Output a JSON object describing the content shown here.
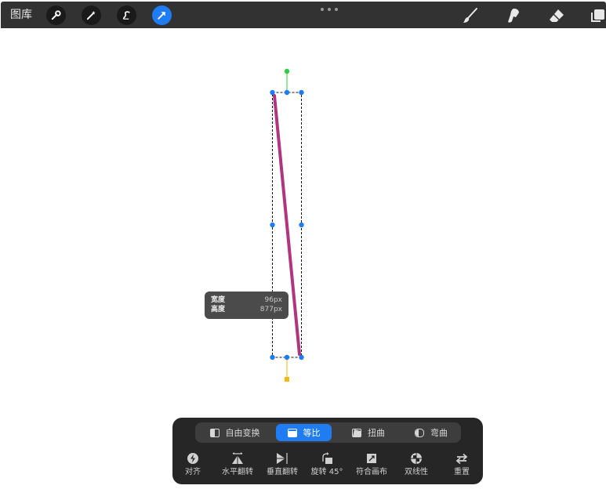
{
  "topbar": {
    "gallery_label": "图库",
    "tools": [
      {
        "icon": "wrench-icon"
      },
      {
        "icon": "magic-wand-icon"
      },
      {
        "icon": "selection-icon"
      },
      {
        "icon": "transform-arrow-icon",
        "active": true
      }
    ],
    "right_tools": [
      {
        "icon": "brush-icon"
      },
      {
        "icon": "smudge-icon"
      },
      {
        "icon": "eraser-icon"
      },
      {
        "icon": "layers-icon"
      }
    ],
    "accent_color": "#1f7cf3",
    "bar_color": "#323232"
  },
  "canvas": {
    "stroke_color": "#b0357e",
    "handle_color": "#1f7cf3",
    "rotate_handle_color": "#2ecc40",
    "anchor_handle_color": "#f5b80f"
  },
  "size_tooltip": {
    "width_label": "宽度",
    "width_value": "96px",
    "height_label": "高度",
    "height_value": "877px"
  },
  "transform_panel": {
    "modes": [
      {
        "label": "自由变换",
        "icon": "free-transform-icon",
        "active": false
      },
      {
        "label": "等比",
        "icon": "uniform-icon",
        "active": true
      },
      {
        "label": "扭曲",
        "icon": "distort-icon",
        "active": false
      },
      {
        "label": "弯曲",
        "icon": "warp-icon",
        "active": false
      }
    ],
    "actions": [
      {
        "label": "对齐",
        "icon": "snapping-icon"
      },
      {
        "label": "水平翻转",
        "icon": "flip-horizontal-icon"
      },
      {
        "label": "垂直翻转",
        "icon": "flip-vertical-icon"
      },
      {
        "label": "旋转 45°",
        "icon": "rotate-45-icon"
      },
      {
        "label": "符合画布",
        "icon": "fit-to-canvas-icon"
      },
      {
        "label": "双线性",
        "icon": "bilinear-icon"
      },
      {
        "label": "重置",
        "icon": "reset-icon"
      }
    ]
  }
}
